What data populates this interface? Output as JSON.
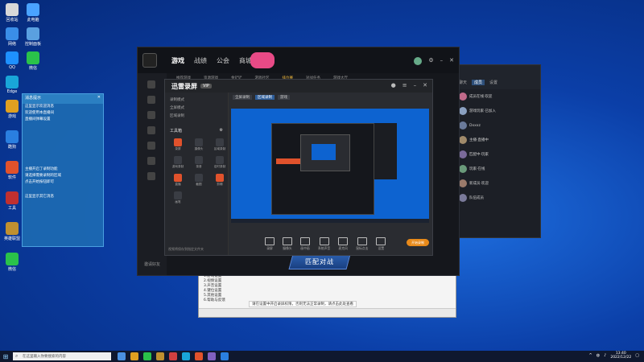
{
  "desktop": {
    "icons": [
      {
        "label": "回收站",
        "color": "#d8d8d8"
      },
      {
        "label": "此电脑",
        "color": "#4aa3ff"
      },
      {
        "label": "网络",
        "color": "#3a8ee8"
      },
      {
        "label": "控制面板",
        "color": "#5aa0e0"
      },
      {
        "label": "QQ",
        "color": "#1e90ff"
      },
      {
        "label": "微信",
        "color": "#2ac24a"
      },
      {
        "label": "Edge",
        "color": "#19a5d8"
      },
      {
        "label": "游戏",
        "color": "#e0a020"
      },
      {
        "label": "酷狗",
        "color": "#2a7fe0"
      },
      {
        "label": "软件",
        "color": "#e0522c"
      },
      {
        "label": "工具",
        "color": "#c03030"
      },
      {
        "label": "英雄联盟",
        "color": "#c09030"
      },
      {
        "label": "微信",
        "color": "#2ac24a"
      }
    ]
  },
  "chat_panel": {
    "title": "消息提示",
    "lines": [
      "这里显示欢迎消息",
      "欢迎使用本直播间",
      "直播间弹幕设置",
      "主播开启了录制功能",
      "请选择需要录制的区域",
      "点击开始按钮即可",
      "这里显示其它消息"
    ]
  },
  "main_app": {
    "nav": [
      "游戏",
      "战绩",
      "公会",
      "商城"
    ],
    "active_nav": 0,
    "subtabs": [
      "推荐游戏",
      "资源游戏",
      "金铲铲",
      "游戏社区",
      "排位赛",
      "对战任务",
      "游戏大厅"
    ],
    "active_subtab": 4,
    "start_button": "匹配对战",
    "cancel_icon": "×",
    "invite": "邀请好友"
  },
  "recorder": {
    "logo": "迅雷录屏",
    "badge": "VIP",
    "left_rows": [
      "录制模式",
      "全屏模式",
      "区域录制"
    ],
    "section_label": "工具箱",
    "tools": [
      {
        "label": "录屏",
        "red": true
      },
      {
        "label": "摄像头",
        "red": false
      },
      {
        "label": "区域录制",
        "red": false
      },
      {
        "label": "游戏录制",
        "red": false
      },
      {
        "label": "录音",
        "red": false
      },
      {
        "label": "定时录制",
        "red": false
      },
      {
        "label": "直播",
        "red": true
      },
      {
        "label": "截图",
        "red": false
      },
      {
        "label": "剪辑",
        "red": true
      },
      {
        "label": "画笔",
        "red": false
      }
    ],
    "footer": "视频将保存到指定文件夹",
    "tabs": [
      "全屏录制",
      "区域录制",
      "游戏"
    ],
    "active_tab": 1,
    "controls": [
      "录屏",
      "摄像头",
      "画中画",
      "系统声音",
      "麦克风",
      "鼠标点击",
      "设置"
    ],
    "start_label": "开始录制"
  },
  "group_window": {
    "tabs": [
      "聊天",
      "成员",
      "设置"
    ],
    "active_tab": 1,
    "members": [
      {
        "name": "成员在线·欢迎",
        "color": "#c06a8a"
      },
      {
        "name": "游戏玩家·已加入",
        "color": "#8aa0c0"
      },
      {
        "name": "Dxxxz",
        "color": "#6a7a9a"
      },
      {
        "name": "主播·直播中",
        "color": "#a08a6a"
      },
      {
        "name": "匹配中·玩家",
        "color": "#7a6a9a"
      },
      {
        "name": "玩家·在线",
        "color": "#6a9a7a"
      },
      {
        "name": "新成员·欢迎",
        "color": "#9a7a6a"
      },
      {
        "name": "队伍成员",
        "color": "#7a7a9a"
      }
    ]
  },
  "bottom_window": {
    "list": [
      "1.游戏设置",
      "2.视频设置",
      "3.声音设置",
      "4.键位设置",
      "5.其他设置",
      "6.帮助与反馈"
    ],
    "notice": "请在设置中开启录屏权限，否则无法正常录制，请点击此处查看"
  },
  "taskbar": {
    "search_placeholder": "在这里输入你要搜索的内容",
    "apps": [
      "#4a90e0",
      "#e0a020",
      "#2ac24a",
      "#c09030",
      "#d04040",
      "#19a5d8",
      "#e0522c",
      "#8060c0",
      "#2a7fe0"
    ],
    "time": "13:40",
    "date": "2022/12/22"
  }
}
